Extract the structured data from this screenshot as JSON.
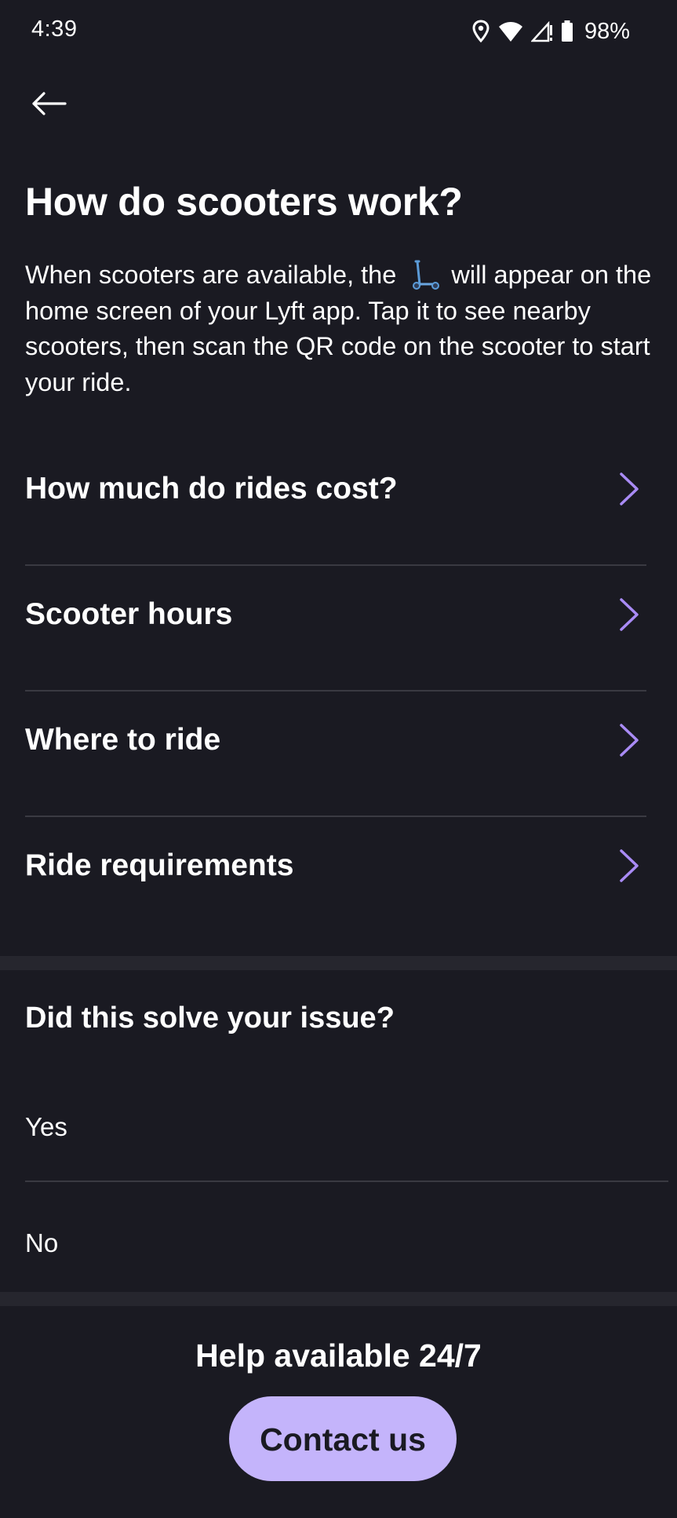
{
  "status_bar": {
    "time": "4:39",
    "battery_percent": "98%",
    "icons": [
      "location-icon",
      "wifi-icon",
      "cellular-signal-icon",
      "battery-icon"
    ]
  },
  "header": {
    "back_icon": "arrow-left-icon"
  },
  "page": {
    "title": "How do scooters work?",
    "intro_before_icon": "When scooters are available, the",
    "intro_inline_icon": "scooter-icon",
    "intro_after_icon": "will appear on the home screen of your Lyft app. Tap it to see nearby scooters, then scan the QR code on the scooter to start your ride."
  },
  "faq": {
    "items": [
      {
        "label": "How much do rides cost?"
      },
      {
        "label": "Scooter hours"
      },
      {
        "label": "Where to ride"
      },
      {
        "label": "Ride requirements"
      }
    ],
    "chevron_icon": "chevron-right-icon"
  },
  "feedback": {
    "title": "Did this solve your issue?",
    "yes_label": "Yes",
    "no_label": "No"
  },
  "footer": {
    "help_text": "Help available 24/7",
    "contact_label": "Contact us"
  },
  "colors": {
    "background": "#1a1a22",
    "accent": "#c4b4fb",
    "chevron": "#a98bf5",
    "divider": "#3a3a42"
  }
}
